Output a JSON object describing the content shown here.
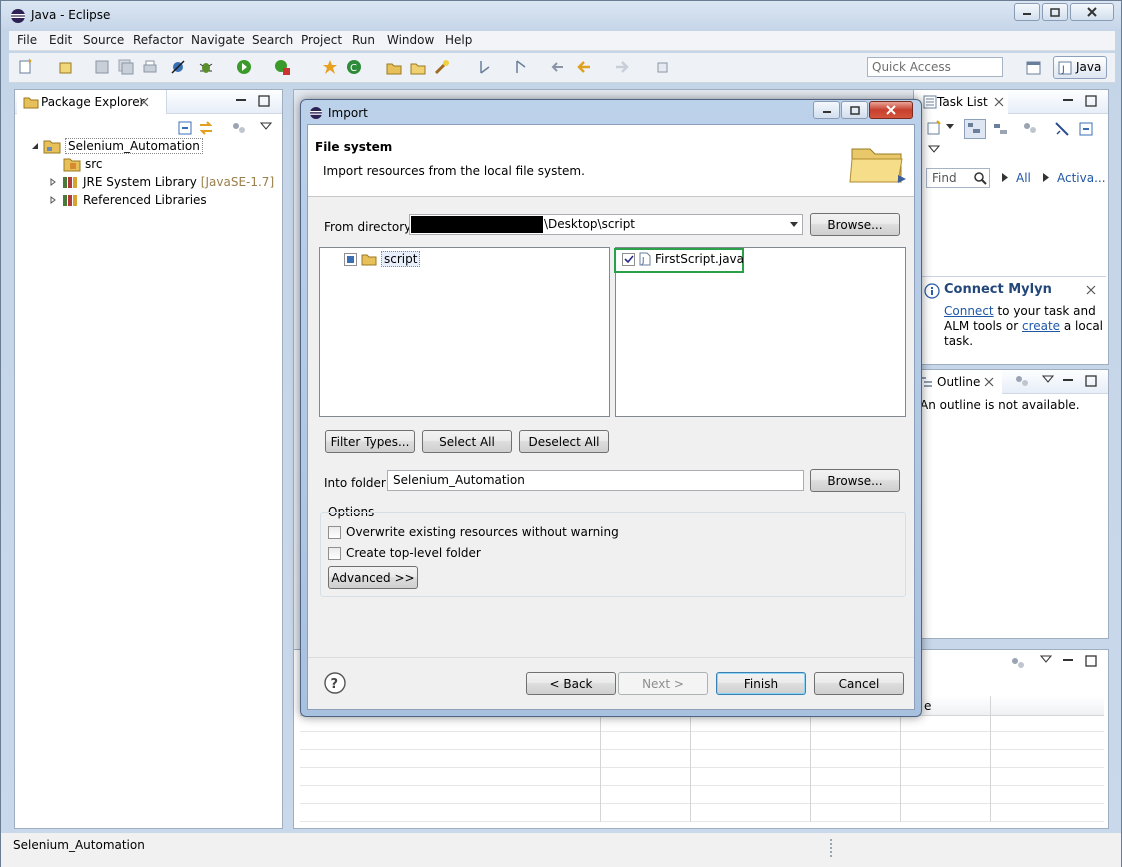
{
  "window": {
    "title": "Java - Eclipse"
  },
  "menu": [
    "File",
    "Edit",
    "Source",
    "Refactor",
    "Navigate",
    "Search",
    "Project",
    "Run",
    "Window",
    "Help"
  ],
  "toolbar": {
    "quick_access_placeholder": "Quick Access",
    "perspective_label": "Java"
  },
  "package_explorer": {
    "tab_label": "Package Explorer",
    "tree": {
      "project": "Selenium_Automation",
      "src": "src",
      "jre": "JRE System Library",
      "jre_suffix": "[JavaSE-1.7]",
      "libs": "Referenced Libraries"
    }
  },
  "task_list": {
    "tab_label": "Task List",
    "find_placeholder": "Find",
    "all_label": "All",
    "activate_label": "Activa..."
  },
  "mylyn": {
    "title": "Connect Mylyn",
    "connect_link": "Connect",
    "text1": "to your task and",
    "text2": "ALM tools or",
    "create_link": "create",
    "text3": "a local",
    "text4": "task."
  },
  "outline": {
    "tab_label": "Outline",
    "message": "An outline is not available."
  },
  "bottom_view": {
    "partial_header": "e"
  },
  "status": {
    "text": "Selenium_Automation"
  },
  "dialog": {
    "title": "Import",
    "heading": "File system",
    "description": "Import resources from the local file system.",
    "from_directory_label": "From directory:",
    "from_directory_value": "\\Desktop\\script",
    "browse_label": "Browse...",
    "folder_tree": [
      {
        "name": "script"
      }
    ],
    "file_list": [
      {
        "name": "FirstScript.java",
        "checked": true
      }
    ],
    "filter_types_label": "Filter Types...",
    "select_all_label": "Select All",
    "deselect_all_label": "Deselect All",
    "into_folder_label": "Into folder:",
    "into_folder_value": "Selenium_Automation",
    "options_label": "Options",
    "overwrite_label": "Overwrite existing resources without warning",
    "overwrite_checked": false,
    "top_level_label": "Create top-level folder",
    "top_level_checked": false,
    "advanced_label": "Advanced >>",
    "back_label": "< Back",
    "next_label": "Next >",
    "finish_label": "Finish",
    "cancel_label": "Cancel"
  }
}
